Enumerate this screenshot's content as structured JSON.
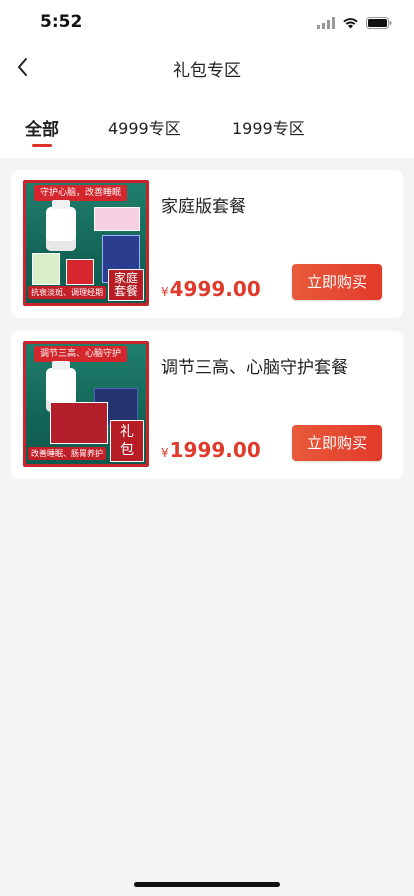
{
  "status": {
    "time": "5:52"
  },
  "nav": {
    "title": "礼包专区"
  },
  "tabs": [
    {
      "label": "全部",
      "active": true
    },
    {
      "label": "4999专区",
      "active": false
    },
    {
      "label": "1999专区",
      "active": false
    }
  ],
  "products": [
    {
      "title": "家庭版套餐",
      "currency": "¥",
      "price": "4999.00",
      "buy_label": "立即购买",
      "image_banner": "守护心脑，改善睡眠",
      "image_corner": "家庭套餐",
      "image_bottom": "抗衰淡斑、调理经期"
    },
    {
      "title": "调节三高、心脑守护套餐",
      "currency": "¥",
      "price": "1999.00",
      "buy_label": "立即购买",
      "image_banner": "调节三高、心脑守护",
      "image_corner": "礼包",
      "image_bottom": "改善睡眠、肠胃养护"
    }
  ],
  "colors": {
    "accent": "#e0302a",
    "price": "#e03a2d"
  }
}
